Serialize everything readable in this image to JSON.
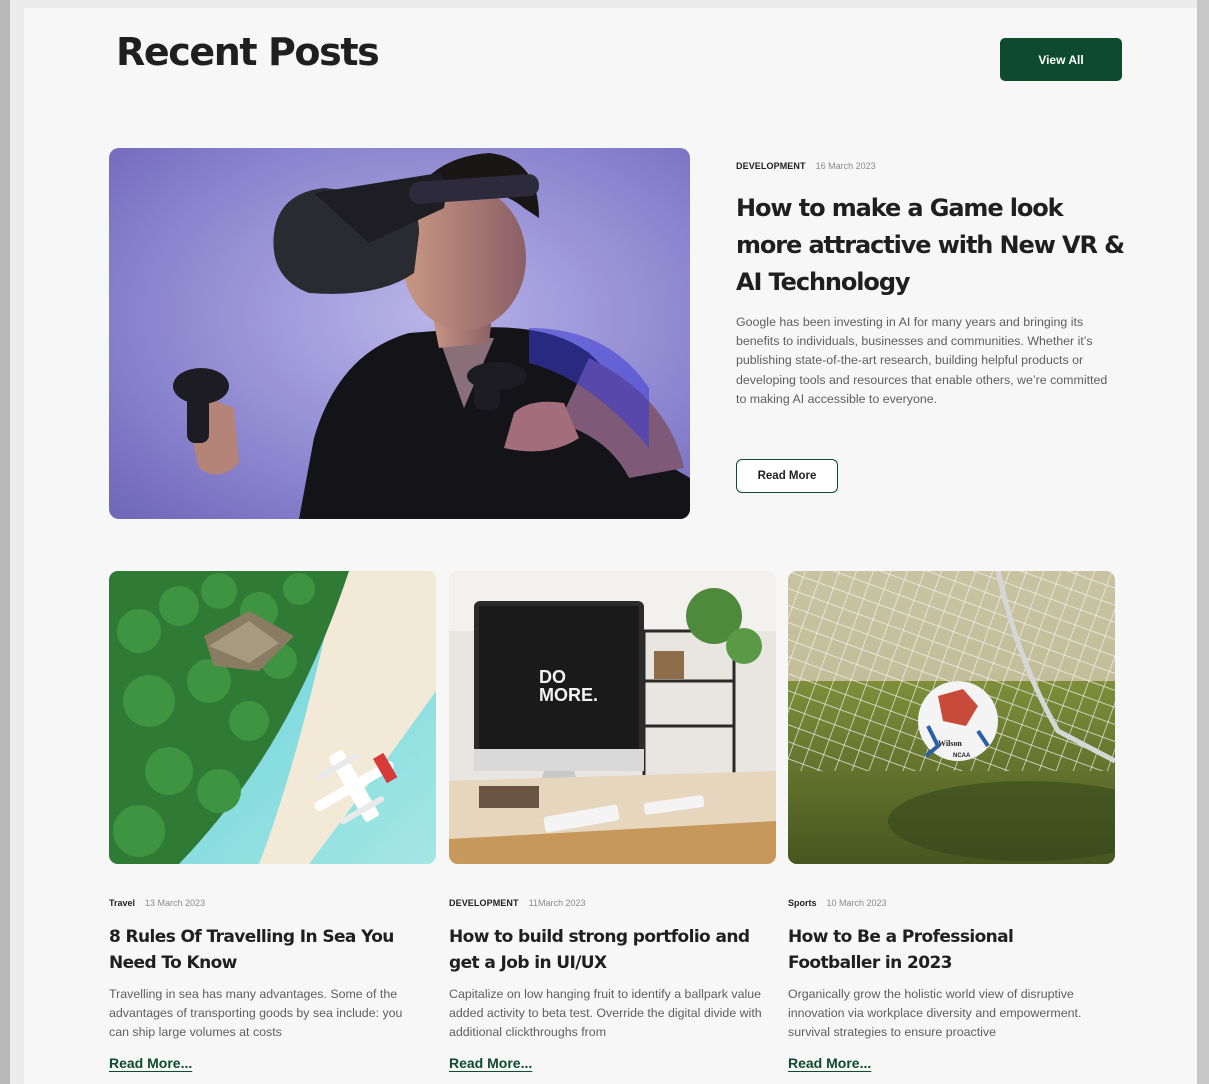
{
  "header": {
    "title": "Recent Posts",
    "view_all_label": "View All"
  },
  "featured": {
    "category": "DEVELOPMENT",
    "date": "16 March 2023",
    "title": "How to make a Game look more attractive with New VR & AI Technology",
    "description": "Google has been investing in AI for many years and bringing its benefits to individuals, businesses and communities. Whether it’s publishing state-of-the-art research, building helpful products or developing tools and resources that enable others, we’re committed to making AI accessible to everyone.",
    "read_more_label": "Read More",
    "image_icon": "vr-headset-photo"
  },
  "cards": [
    {
      "category": "Travel",
      "date": "13 March 2023",
      "title": "8 Rules Of Travelling In Sea You Need To Know",
      "description": "Travelling in sea has many advantages. Some of the advantages of transporting goods by sea include: you can ship large volumes at costs",
      "link_label": "Read More...",
      "image_icon": "island-seaplane-photo"
    },
    {
      "category": "DEVELOPMENT",
      "date": "11March 2023",
      "title": "How to build strong portfolio and get a Job in UI/UX",
      "description": "Capitalize on low hanging fruit to identify a ballpark value added activity to beta test. Override the digital divide with additional clickthroughs from",
      "link_label": "Read More...",
      "image_icon": "desk-monitor-photo",
      "screen_text": [
        "DO",
        "MORE."
      ]
    },
    {
      "category": "Sports",
      "date": "10 March 2023",
      "title": "How to Be a Professional Footballer in 2023",
      "description": "Organically grow the holistic world view of disruptive innovation via workplace diversity and empowerment. survival strategies to ensure proactive",
      "link_label": "Read More...",
      "image_icon": "football-goal-photo",
      "ball_text": [
        "Wilson",
        "NCAA"
      ]
    }
  ],
  "colors": {
    "brand_green": "#0e4a2d",
    "background": "#f7f7f7",
    "text_dark": "#1f1f1f",
    "text_muted": "#5e5e5e"
  }
}
